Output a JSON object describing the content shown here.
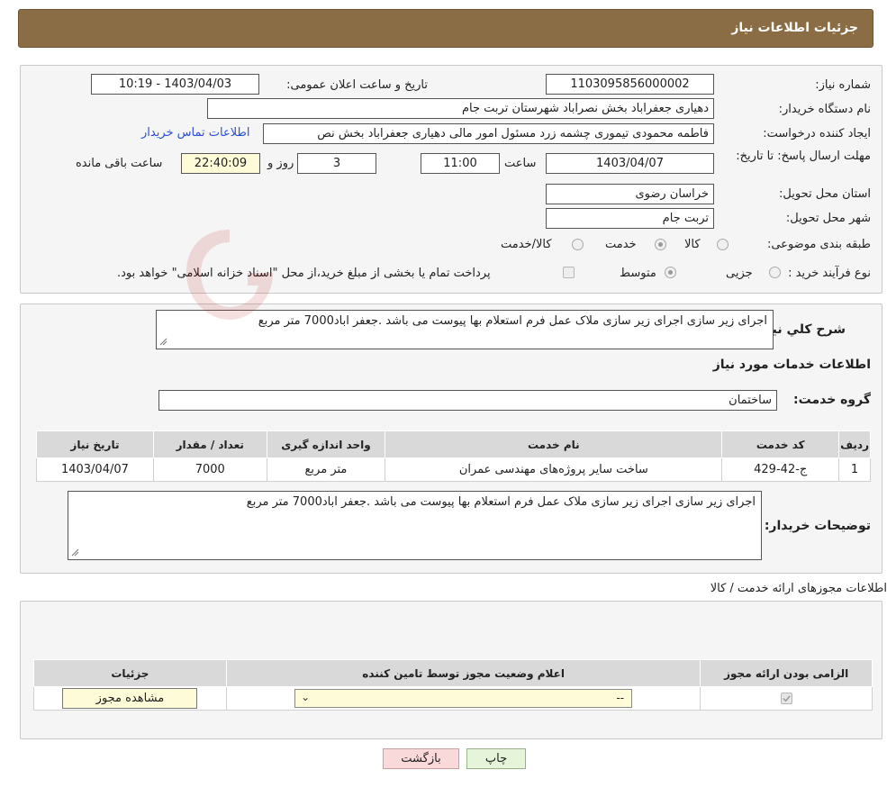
{
  "header": {
    "title": "جزئیات اطلاعات نیاز"
  },
  "form": {
    "need_number_label": "شماره نیاز:",
    "need_number": "1103095856000002",
    "announce_label": "تاریخ و ساعت اعلان عمومی:",
    "announce_value": "1403/04/03 - 10:19",
    "buyer_org_label": "نام دستگاه خریدار:",
    "buyer_org": "دهیاری جعفراباد بخش نصراباد شهرستان تربت جام",
    "creator_label": "ایجاد کننده درخواست:",
    "creator": "فاطمه محمودی تیموری چشمه زرد مسئول امور مالی دهیاری جعفراباد بخش نص",
    "contact_link": "اطلاعات تماس خریدار",
    "deadline_label": "مهلت ارسال پاسخ: تا تاریخ:",
    "deadline_date": "1403/04/07",
    "time_label": "ساعت",
    "deadline_time": "11:00",
    "days_value": "3",
    "days_label": "روز و",
    "remaining_time": "22:40:09",
    "remaining_label": "ساعت باقی مانده",
    "province_label": "استان محل تحویل:",
    "province": "خراسان رضوی",
    "city_label": "شهر محل تحویل:",
    "city": "تربت جام",
    "category_label": "طبقه بندی موضوعی:",
    "category_options": [
      "کالا",
      "خدمت",
      "کالا/خدمت"
    ],
    "category_selected": "خدمت",
    "process_label": "نوع فرآیند خرید :",
    "process_options": [
      "جزیی",
      "متوسط"
    ],
    "process_selected": "متوسط",
    "payment_note": "پرداخت تمام یا بخشی از مبلغ خرید،از محل \"اسناد خزانه اسلامی\" خواهد بود."
  },
  "summary": {
    "label": "شرح کلي نياز:",
    "text": "اجرای زیر سازی  اجرای زیر سازی ملاک عمل فرم استعلام بها پیوست می باشد .جعفر اباد7000 متر مربع",
    "services_title": "اطلاعات خدمات مورد نياز",
    "group_label": "گروه خدمت:",
    "group_value": "ساختمان"
  },
  "services_table": {
    "headers": [
      "رديف",
      "کد خدمت",
      "نام خدمت",
      "واحد اندازه گیری",
      "تعداد / مقدار",
      "تاریخ نیاز"
    ],
    "rows": [
      [
        "1",
        "ج-42-429",
        "ساخت سایر پروژه‌های مهندسی عمران",
        "متر مربع",
        "7000",
        "1403/04/07"
      ]
    ]
  },
  "buyer_notes": {
    "label": "توضیحات خریدار:",
    "text": "اجرای زیر سازی  اجرای زیر سازی ملاک عمل فرم استعلام بها پیوست می باشد .جعفر اباد7000 متر مربع"
  },
  "permits": {
    "title": "اطلاعات مجوزهای ارائه خدمت / کالا",
    "headers": [
      "الزامی بودن ارائه مجوز",
      "اعلام وضعیت مجوز توسط تامین کننده",
      "جزئیات"
    ],
    "select_value": "--",
    "view_button": "مشاهده مجوز"
  },
  "actions": {
    "print": "چاپ",
    "back": "بازگشت"
  },
  "colors": {
    "header_bg": "#8a6d45",
    "panel_bg": "#f5f5f5",
    "remaining_bg": "#fdfbd8",
    "back_btn_bg": "#f9d9d9",
    "print_btn_bg": "#e6f4d9",
    "link": "#2b4fd8"
  }
}
